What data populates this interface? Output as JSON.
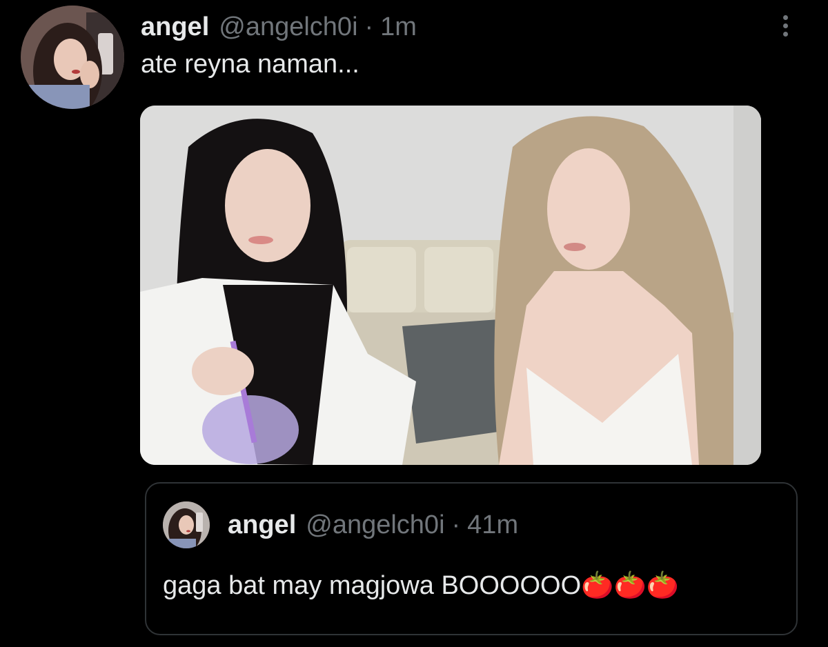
{
  "tweet": {
    "display_name": "angel",
    "handle": "@angelch0i",
    "separator": "·",
    "time": "1m",
    "text": "ate reyna naman..."
  },
  "quoted": {
    "display_name": "angel",
    "handle": "@angelch0i",
    "separator": "·",
    "time": "41m",
    "text": "gaga bat may magjowa BOOOOOO🍅🍅🍅"
  },
  "icons": {
    "more": "more-options-icon"
  },
  "colors": {
    "background": "#000000",
    "primary_text": "#e7e9ea",
    "secondary_text": "#71767b",
    "border": "#2f3336"
  }
}
